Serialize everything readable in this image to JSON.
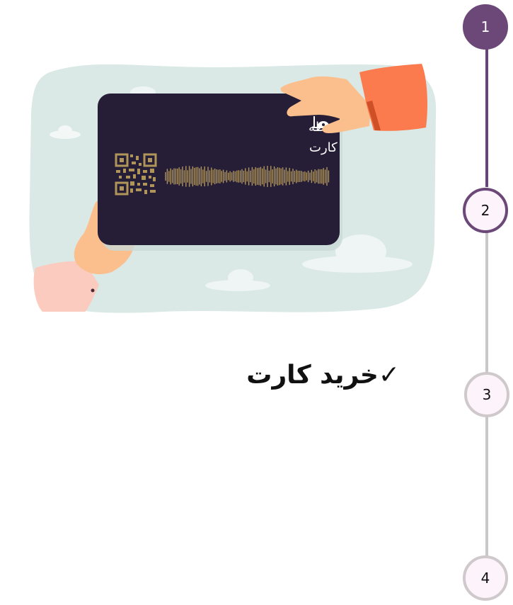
{
  "stepper": {
    "steps": [
      {
        "number": "1",
        "state": "done"
      },
      {
        "number": "2",
        "state": "current"
      },
      {
        "number": "3",
        "state": "pending"
      },
      {
        "number": "4",
        "state": "pending"
      }
    ]
  },
  "illustration": {
    "card_brand_line1": "لحظه",
    "card_brand_line2": "کارت"
  },
  "main": {
    "title": "خرید کارت",
    "check_mark": "✓"
  },
  "colors": {
    "accent": "#6b4878",
    "inactive_line": "#c8c8c8",
    "card": "#261e37",
    "gold": "#b0955a",
    "sleeve_orange": "#fb7a4e",
    "sky": "#dae9e5"
  }
}
